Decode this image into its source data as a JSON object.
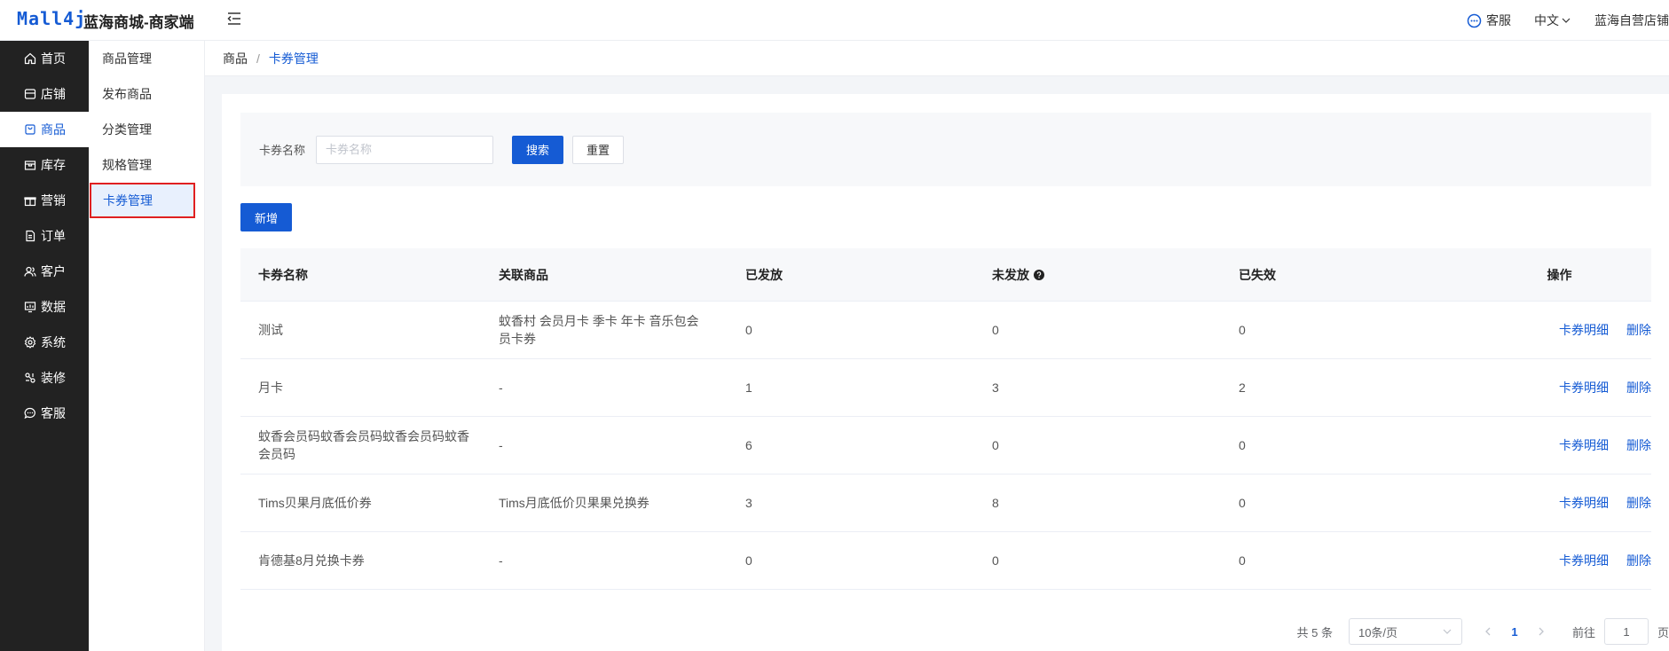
{
  "header": {
    "logo": "Mall4j",
    "brand": "蓝海商城-商家端",
    "service": "客服",
    "language": "中文",
    "shop": "蓝海自营店铺"
  },
  "nav": [
    {
      "label": "首页",
      "icon": "home-icon"
    },
    {
      "label": "店铺",
      "icon": "shop-icon"
    },
    {
      "label": "商品",
      "icon": "product-icon"
    },
    {
      "label": "库存",
      "icon": "inventory-icon"
    },
    {
      "label": "营销",
      "icon": "gift-icon"
    },
    {
      "label": "订单",
      "icon": "order-icon"
    },
    {
      "label": "客户",
      "icon": "customer-icon"
    },
    {
      "label": "数据",
      "icon": "data-icon"
    },
    {
      "label": "系统",
      "icon": "settings-icon"
    },
    {
      "label": "装修",
      "icon": "decoration-icon"
    },
    {
      "label": "客服",
      "icon": "chat-icon"
    }
  ],
  "subnav": [
    "商品管理",
    "发布商品",
    "分类管理",
    "规格管理",
    "卡券管理"
  ],
  "breadcrumb": {
    "parent": "商品",
    "separator": "/",
    "current": "卡券管理"
  },
  "search": {
    "label": "卡券名称",
    "placeholder": "卡券名称",
    "search_btn": "搜索",
    "reset_btn": "重置"
  },
  "add_btn": "新增",
  "table": {
    "headers": [
      "卡券名称",
      "关联商品",
      "已发放",
      "未发放",
      "已失效",
      "操作"
    ],
    "rows": [
      {
        "name": "测试",
        "product": "蚊香村 会员月卡 季卡 年卡 音乐包会员卡券",
        "issued": "0",
        "unissued": "0",
        "expired": "0"
      },
      {
        "name": "月卡",
        "product": "-",
        "issued": "1",
        "unissued": "3",
        "expired": "2"
      },
      {
        "name": "蚊香会员码蚊香会员码蚊香会员码蚊香会员码",
        "product": "-",
        "issued": "6",
        "unissued": "0",
        "expired": "0"
      },
      {
        "name": "Tims贝果月底低价券",
        "product": "Tims月底低价贝果果兑换券",
        "issued": "3",
        "unissued": "8",
        "expired": "0"
      },
      {
        "name": "肯德基8月兑换卡券",
        "product": "-",
        "issued": "0",
        "unissued": "0",
        "expired": "0"
      }
    ],
    "op_detail": "卡券明细",
    "op_delete": "删除"
  },
  "pager": {
    "total": "共 5 条",
    "size": "10条/页",
    "current": "1",
    "goto_label": "前往",
    "goto_value": "1",
    "page_suffix": "页"
  },
  "colors": {
    "primary": "#155bd4",
    "nav_bg": "#222222",
    "highlight_border": "#e02020"
  }
}
